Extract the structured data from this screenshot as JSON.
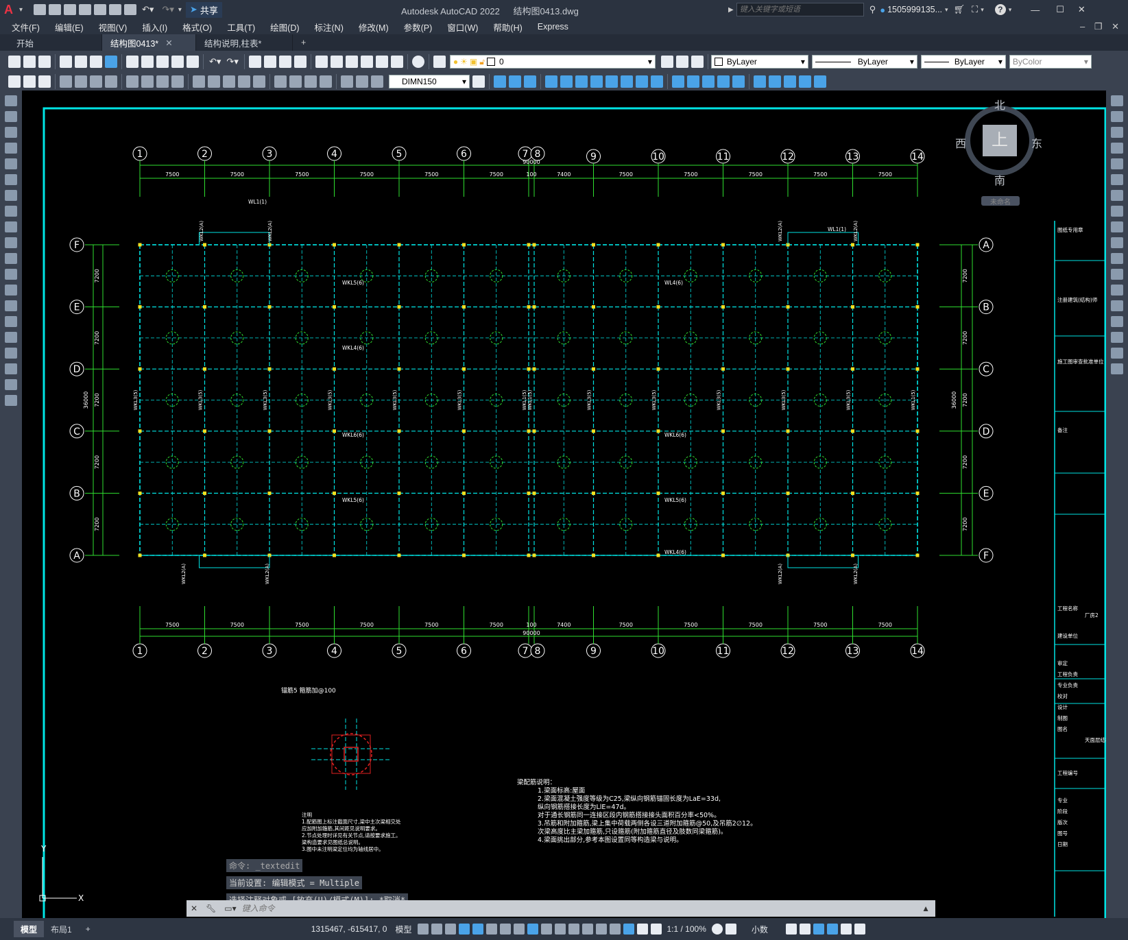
{
  "titlebar": {
    "app_title": "Autodesk AutoCAD 2022",
    "file_name": "结构图0413.dwg",
    "share_label": "共享",
    "search_placeholder": "键入关键字或短语",
    "user_name": "1505999135..."
  },
  "menu": [
    "文件(F)",
    "编辑(E)",
    "视图(V)",
    "插入(I)",
    "格式(O)",
    "工具(T)",
    "绘图(D)",
    "标注(N)",
    "修改(M)",
    "参数(P)",
    "窗口(W)",
    "帮助(H)",
    "Express"
  ],
  "tabs": [
    {
      "label": "开始",
      "active": false,
      "closable": false
    },
    {
      "label": "结构图0413*",
      "active": true,
      "closable": true
    },
    {
      "label": "结构说明,柱表*",
      "active": false,
      "closable": false
    }
  ],
  "toolbar": {
    "layer_value": "0",
    "color_value": "ByLayer",
    "linetype_value": "ByLayer",
    "lineweight_value": "ByLayer",
    "plotstyle_value": "ByColor",
    "dimstyle_value": "DIMN150"
  },
  "viewcube": {
    "north": "北",
    "south": "南",
    "east": "东",
    "west": "西",
    "top": "上",
    "ucs_label": "未命名"
  },
  "drawing": {
    "axis_top": [
      "1",
      "2",
      "3",
      "4",
      "5",
      "6",
      "7",
      "8",
      "9",
      "10",
      "11",
      "12",
      "13",
      "14"
    ],
    "spacings": [
      "7500",
      "7500",
      "7500",
      "7500",
      "7500",
      "7500",
      "100",
      "7400",
      "7500",
      "7500",
      "7500",
      "7500",
      "7500"
    ],
    "total_width": "90000",
    "left_rows": [
      "F",
      "E",
      "D",
      "C",
      "B",
      "A"
    ],
    "right_rows": [
      "A",
      "B",
      "C",
      "D",
      "E",
      "F"
    ],
    "row_spacing": "7200",
    "total_height": "36000",
    "beam_labels": [
      "WL1(1)",
      "WL4(6)",
      "WL5(6)",
      "WKL6(6)",
      "WKL5(6)",
      "WKL4(6)",
      "WKL3(5)",
      "WKL1(5)",
      "WKL2(A)"
    ],
    "detail_label": "锚筋5 箍筋加@100",
    "notes_title": "梁配筋说明：",
    "notes": [
      "1.梁面标高:屋面",
      "2.梁面混凝土强度等级为C25,梁纵向钢筋锚固长度为LaE=33d,",
      "  纵向钢筋搭接长度为LlE=47d。",
      "  对于通长钢筋同一连接区段内钢筋搭接接头面积百分率<50%。",
      "3.吊筋和附加箍筋,梁上集中荷载两侧各设三道附加箍筋@50,及吊筋2∅12。",
      "  次梁高度比主梁加箍筋,只设箍筋(附加箍筋直径及肢数同梁箍筋)。",
      "4.梁面挑出部分,参考本图设置同等构造梁与说明。"
    ],
    "side_notes_title": "注明",
    "side_notes": [
      "1.配筋图上标注截面尺寸,梁中主次梁相交处",
      "  应加附加箍筋,其间距见说明要求。",
      "2.节点处理时详见有关节点,请按要求施工。",
      "  梁构造要求见图纸总说明。",
      "3.图中未注明梁定位均为轴线居中。"
    ],
    "title_block_labels": [
      "图纸专用章",
      "注册建筑(结构)师",
      "施工图审查批准单位",
      "备注",
      "工程名称",
      "厂房2",
      "建设单位",
      "审定",
      "工程负责",
      "专业负责",
      "校对",
      "设计",
      "制图",
      "图名",
      "天面层结构",
      "工程编号",
      "专业",
      "阶段",
      "版次",
      "图号",
      "日期"
    ]
  },
  "command": {
    "history": [
      "命令: _textedit",
      "当前设置: 编辑模式 = Multiple",
      "选择注释对象或 [放弃(U)/模式(M)]: *取消*"
    ],
    "placeholder": "键入命令"
  },
  "layout_tabs": [
    "模型",
    "布局1"
  ],
  "status": {
    "coords": "1315467, -615417, 0",
    "model_label": "模型",
    "scale": "1:1 / 100%",
    "units": "小数"
  }
}
